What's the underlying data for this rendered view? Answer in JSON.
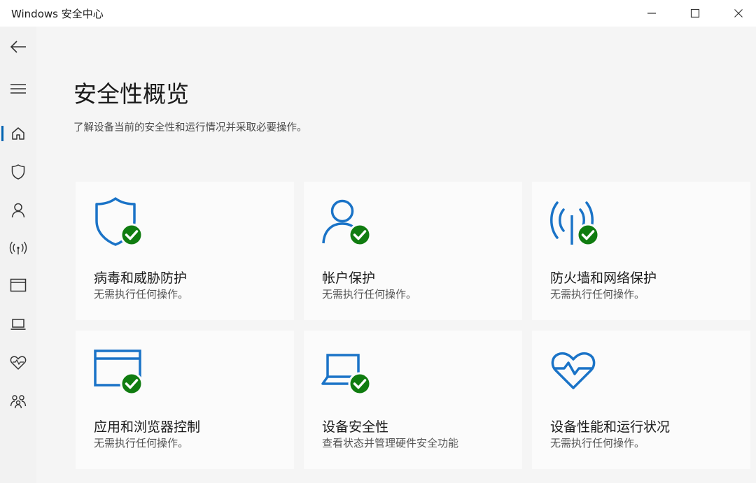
{
  "window": {
    "title": "Windows 安全中心",
    "controls": [
      "minimize",
      "maximize",
      "close"
    ]
  },
  "colors": {
    "accent": "#0063b1",
    "icon_blue": "#1a73c7",
    "check_green": "#107c10",
    "sidebar_bg": "#f2f2f2",
    "content_bg": "#f5f5f5",
    "tile_bg": "#fbfbfb"
  },
  "sidebar": {
    "items": [
      {
        "icon": "back-arrow-icon"
      },
      {
        "icon": "hamburger-menu-icon"
      },
      {
        "icon": "home-icon",
        "active": true
      },
      {
        "icon": "shield-icon"
      },
      {
        "icon": "person-icon"
      },
      {
        "icon": "wireless-signal-icon"
      },
      {
        "icon": "app-browser-icon"
      },
      {
        "icon": "laptop-icon"
      },
      {
        "icon": "heart-pulse-icon"
      },
      {
        "icon": "family-icon"
      }
    ]
  },
  "main": {
    "title": "安全性概览",
    "subtitle": "了解设备当前的安全性和运行情况并采取必要操作。",
    "tiles": [
      {
        "name": "病毒和威胁防护",
        "status": "无需执行任何操作。",
        "icon": "shield-check-icon"
      },
      {
        "name": "帐户保护",
        "status": "无需执行任何操作。",
        "icon": "account-check-icon"
      },
      {
        "name": "防火墙和网络保护",
        "status": "无需执行任何操作。",
        "icon": "firewall-antenna-check-icon"
      },
      {
        "name": "应用和浏览器控制",
        "status": "无需执行任何操作。",
        "icon": "app-window-check-icon"
      },
      {
        "name": "设备安全性",
        "status": "查看状态并管理硬件安全功能",
        "icon": "laptop-check-icon"
      },
      {
        "name": "设备性能和运行状况",
        "status": "无需执行任何操作。",
        "icon": "heart-pulse-icon"
      }
    ]
  }
}
